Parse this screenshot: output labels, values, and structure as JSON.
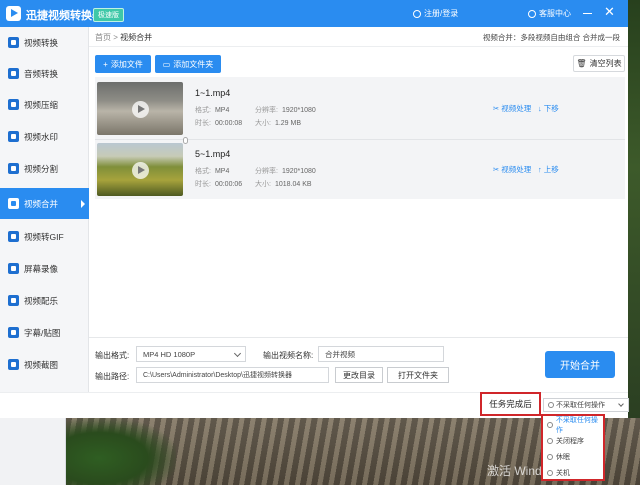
{
  "app": {
    "title": "迅捷视频转换器",
    "badge": "极速版",
    "login": "注册/登录",
    "service": "客服中心",
    "close": "✕"
  },
  "sidebar": {
    "items": [
      {
        "label": "视频转换",
        "icon": "video-convert-icon"
      },
      {
        "label": "音频转换",
        "icon": "audio-convert-icon"
      },
      {
        "label": "视频压缩",
        "icon": "video-compress-icon"
      },
      {
        "label": "视频水印",
        "icon": "video-watermark-icon"
      },
      {
        "label": "视频分割",
        "icon": "video-split-icon"
      },
      {
        "label": "视频合并",
        "icon": "video-merge-icon",
        "active": true
      },
      {
        "label": "视频转GIF",
        "icon": "video-gif-icon"
      },
      {
        "label": "屏幕录像",
        "icon": "screen-record-icon"
      },
      {
        "label": "视频配乐",
        "icon": "video-music-icon"
      },
      {
        "label": "字幕/贴图",
        "icon": "subtitle-icon"
      },
      {
        "label": "视频截图",
        "icon": "video-screenshot-icon"
      }
    ]
  },
  "breadcrumb": {
    "home": "首页",
    "sep": ">",
    "current": "视频合并",
    "description": "视频合并：多段视频自由组合 合并成一段"
  },
  "toolbar": {
    "add_file": "添加文件",
    "add_folder": "添加文件夹",
    "clear_list": "清空列表"
  },
  "files": [
    {
      "name": "1~1.mp4",
      "format_label": "格式:",
      "format": "MP4",
      "resolution_label": "分辨率:",
      "resolution": "1920*1080",
      "duration_label": "时长:",
      "duration": "00:00:08",
      "size_label": "大小:",
      "size": "1.29 MB",
      "process": "视频处理",
      "move": "下移"
    },
    {
      "name": "5~1.mp4",
      "format_label": "格式:",
      "format": "MP4",
      "resolution_label": "分辨率:",
      "resolution": "1920*1080",
      "duration_label": "时长:",
      "duration": "00:00:06",
      "size_label": "大小:",
      "size": "1018.04 KB",
      "process": "视频处理",
      "move": "上移"
    }
  ],
  "output": {
    "format_label": "输出格式:",
    "format_value": "MP4  HD 1080P",
    "name_label": "输出视频名称:",
    "name_value": "合并视频",
    "path_label": "输出路径:",
    "path_value": "C:\\Users\\Administrator\\Desktop\\迅捷视频转换器",
    "change_dir": "更改目录",
    "open_folder": "打开文件夹",
    "start": "开始合并"
  },
  "after_task": {
    "label": "任务完成后",
    "selected": "不采取任何操作",
    "options": [
      "不采取任何操作",
      "关闭程序",
      "休眠",
      "关机"
    ]
  },
  "desktop": {
    "watermark": "激活 Windows"
  },
  "colors": {
    "accent": "#2a8cf0",
    "highlight_border": "#d0262a"
  }
}
